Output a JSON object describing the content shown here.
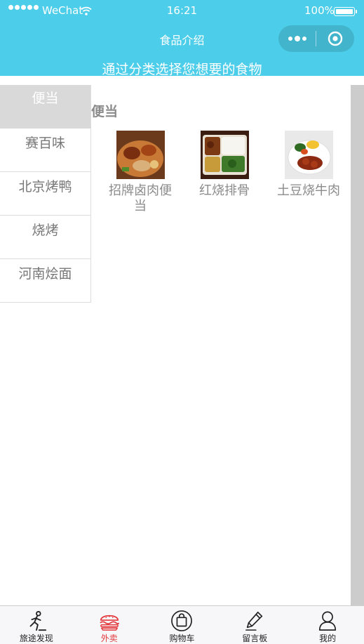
{
  "status_bar": {
    "carrier": "WeChat",
    "time": "16:21",
    "battery": "100%"
  },
  "nav": {
    "title": "食品介绍"
  },
  "subtitle": "通过分类选择您想要的食物",
  "categories": [
    {
      "label": "便当"
    },
    {
      "label": "赛百味"
    },
    {
      "label": "北京烤鸭"
    },
    {
      "label": "烧烤"
    },
    {
      "label": "河南烩面"
    }
  ],
  "section": {
    "title": "便当"
  },
  "foods": [
    {
      "name": "招牌卤肉便当"
    },
    {
      "name": "红烧排骨"
    },
    {
      "name": "土豆烧牛肉"
    }
  ],
  "tabs": [
    {
      "label": "旅途发现",
      "icon": "runner-icon"
    },
    {
      "label": "外卖",
      "icon": "burger-icon"
    },
    {
      "label": "购物车",
      "icon": "shopping-bag-icon"
    },
    {
      "label": "留言板",
      "icon": "pencil-icon"
    },
    {
      "label": "我的",
      "icon": "user-icon"
    }
  ],
  "colors": {
    "header": "#4ccde9",
    "active_tab": "#e4393c",
    "active_category_bg": "#d9d9d9",
    "text_gray": "#8b8b8b"
  }
}
